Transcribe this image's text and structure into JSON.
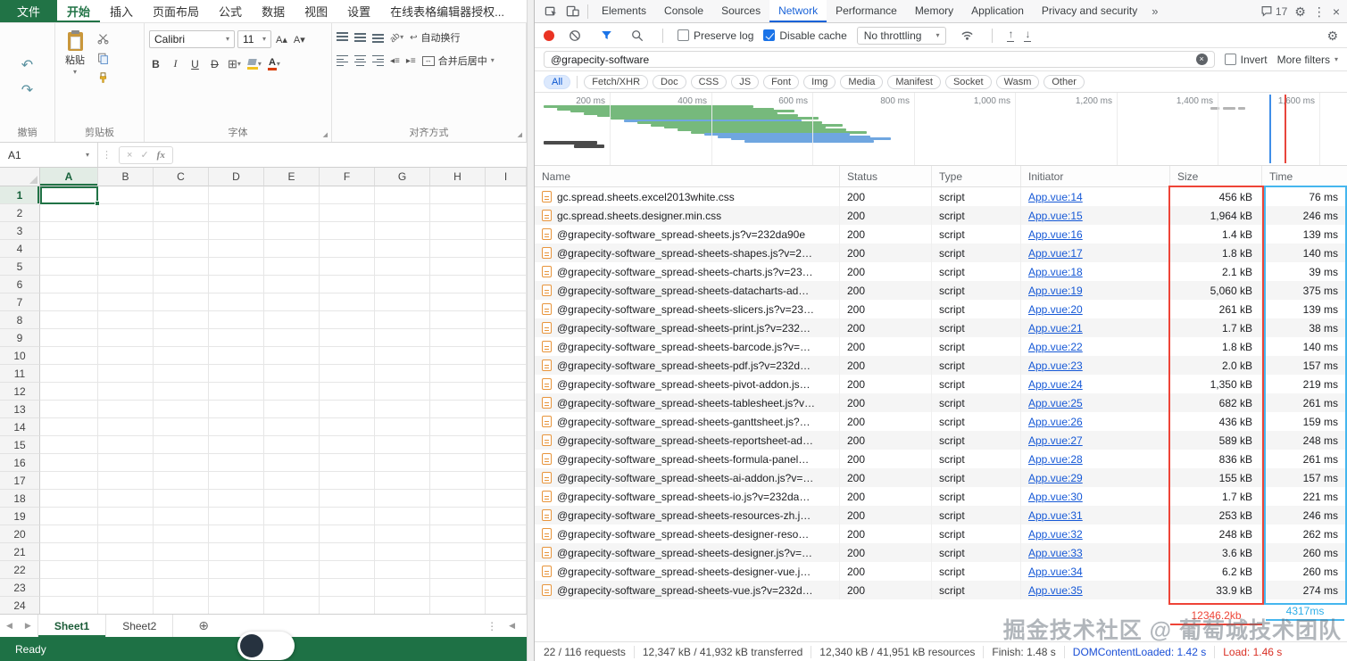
{
  "icons": {
    "undo": "↶",
    "redo": "↷",
    "caret": "▾",
    "kebab": "⋮",
    "close": "×",
    "gear": "⚙",
    "more_tabs": "»",
    "check": "✓",
    "cancel": "×",
    "clear": "×",
    "plus": "⊕",
    "nav_left": "◀",
    "nav_right": "▶",
    "increase_font": "A▴",
    "decrease_font": "A▾",
    "wrap": "↩",
    "merge_arrows": "↔",
    "orientation": "ab",
    "bold": "B",
    "italic": "I",
    "underline": "U",
    "strikethrough": "D",
    "font_color": "A",
    "borders_grid": "⊞",
    "indent_decrease": "◂≡",
    "indent_increase": "▸≡",
    "launcher": "◢"
  },
  "spreadsheet": {
    "menu": {
      "file_tab": "文件",
      "tabs": [
        "开始",
        "插入",
        "页面布局",
        "公式",
        "数据",
        "视图",
        "设置",
        "在线表格编辑器授权..."
      ],
      "active_tab": "开始"
    },
    "ribbon": {
      "groups": {
        "undo": "撤销",
        "clipboard": "剪贴板",
        "font": "字体",
        "alignment": "对齐方式"
      },
      "paste_label": "粘贴",
      "font_name": "Calibri",
      "font_size": "11",
      "wrap_label": "自动换行",
      "merge_label": "合并后居中"
    },
    "formula_bar": {
      "cell_ref": "A1",
      "fx_label": "fx"
    },
    "grid": {
      "columns": [
        "A",
        "B",
        "C",
        "D",
        "E",
        "F",
        "G",
        "H",
        "I"
      ],
      "visible_rows": 24,
      "selected_cell": "A1",
      "selected_column": "A",
      "selected_row": 1
    },
    "sheets": [
      "Sheet1",
      "Sheet2"
    ],
    "active_sheet": "Sheet1",
    "status_text": "Ready"
  },
  "devtools": {
    "tabs": [
      "Elements",
      "Console",
      "Sources",
      "Network",
      "Performance",
      "Memory",
      "Application",
      "Privacy and security"
    ],
    "active_tab": "Network",
    "issues_count": "17",
    "toolbar": {
      "preserve_log": "Preserve log",
      "disable_cache": "Disable cache",
      "throttling": "No throttling"
    },
    "filter": {
      "value": "@grapecity-software",
      "invert": "Invert",
      "more_filters": "More filters"
    },
    "chips": [
      "All",
      "Fetch/XHR",
      "Doc",
      "CSS",
      "JS",
      "Font",
      "Img",
      "Media",
      "Manifest",
      "Socket",
      "Wasm",
      "Other"
    ],
    "active_chip": "All",
    "overview_ticks": [
      "200 ms",
      "400 ms",
      "600 ms",
      "800 ms",
      "1,000 ms",
      "1,200 ms",
      "1,400 ms",
      "1,600 ms"
    ],
    "table": {
      "columns": [
        "Name",
        "Status",
        "Type",
        "Initiator",
        "Size",
        "Time"
      ],
      "requests": [
        {
          "name": "gc.spread.sheets.excel2013white.css",
          "status": "200",
          "type": "script",
          "initiator": "App.vue:14",
          "size": "456 kB",
          "time": "76 ms"
        },
        {
          "name": "gc.spread.sheets.designer.min.css",
          "status": "200",
          "type": "script",
          "initiator": "App.vue:15",
          "size": "1,964 kB",
          "time": "246 ms"
        },
        {
          "name": "@grapecity-software_spread-sheets.js?v=232da90e",
          "status": "200",
          "type": "script",
          "initiator": "App.vue:16",
          "size": "1.4 kB",
          "time": "139 ms"
        },
        {
          "name": "@grapecity-software_spread-sheets-shapes.js?v=2…",
          "status": "200",
          "type": "script",
          "initiator": "App.vue:17",
          "size": "1.8 kB",
          "time": "140 ms"
        },
        {
          "name": "@grapecity-software_spread-sheets-charts.js?v=23…",
          "status": "200",
          "type": "script",
          "initiator": "App.vue:18",
          "size": "2.1 kB",
          "time": "39 ms"
        },
        {
          "name": "@grapecity-software_spread-sheets-datacharts-ad…",
          "status": "200",
          "type": "script",
          "initiator": "App.vue:19",
          "size": "5,060 kB",
          "time": "375 ms"
        },
        {
          "name": "@grapecity-software_spread-sheets-slicers.js?v=23…",
          "status": "200",
          "type": "script",
          "initiator": "App.vue:20",
          "size": "261 kB",
          "time": "139 ms"
        },
        {
          "name": "@grapecity-software_spread-sheets-print.js?v=232…",
          "status": "200",
          "type": "script",
          "initiator": "App.vue:21",
          "size": "1.7 kB",
          "time": "38 ms"
        },
        {
          "name": "@grapecity-software_spread-sheets-barcode.js?v=…",
          "status": "200",
          "type": "script",
          "initiator": "App.vue:22",
          "size": "1.8 kB",
          "time": "140 ms"
        },
        {
          "name": "@grapecity-software_spread-sheets-pdf.js?v=232d…",
          "status": "200",
          "type": "script",
          "initiator": "App.vue:23",
          "size": "2.0 kB",
          "time": "157 ms"
        },
        {
          "name": "@grapecity-software_spread-sheets-pivot-addon.js…",
          "status": "200",
          "type": "script",
          "initiator": "App.vue:24",
          "size": "1,350 kB",
          "time": "219 ms"
        },
        {
          "name": "@grapecity-software_spread-sheets-tablesheet.js?v…",
          "status": "200",
          "type": "script",
          "initiator": "App.vue:25",
          "size": "682 kB",
          "time": "261 ms"
        },
        {
          "name": "@grapecity-software_spread-sheets-ganttsheet.js?…",
          "status": "200",
          "type": "script",
          "initiator": "App.vue:26",
          "size": "436 kB",
          "time": "159 ms"
        },
        {
          "name": "@grapecity-software_spread-sheets-reportsheet-ad…",
          "status": "200",
          "type": "script",
          "initiator": "App.vue:27",
          "size": "589 kB",
          "time": "248 ms"
        },
        {
          "name": "@grapecity-software_spread-sheets-formula-panel…",
          "status": "200",
          "type": "script",
          "initiator": "App.vue:28",
          "size": "836 kB",
          "time": "261 ms"
        },
        {
          "name": "@grapecity-software_spread-sheets-ai-addon.js?v=…",
          "status": "200",
          "type": "script",
          "initiator": "App.vue:29",
          "size": "155 kB",
          "time": "157 ms"
        },
        {
          "name": "@grapecity-software_spread-sheets-io.js?v=232da…",
          "status": "200",
          "type": "script",
          "initiator": "App.vue:30",
          "size": "1.7 kB",
          "time": "221 ms"
        },
        {
          "name": "@grapecity-software_spread-sheets-resources-zh.j…",
          "status": "200",
          "type": "script",
          "initiator": "App.vue:31",
          "size": "253 kB",
          "time": "246 ms"
        },
        {
          "name": "@grapecity-software_spread-sheets-designer-reso…",
          "status": "200",
          "type": "script",
          "initiator": "App.vue:32",
          "size": "248 kB",
          "time": "262 ms"
        },
        {
          "name": "@grapecity-software_spread-sheets-designer.js?v=…",
          "status": "200",
          "type": "script",
          "initiator": "App.vue:33",
          "size": "3.6 kB",
          "time": "260 ms"
        },
        {
          "name": "@grapecity-software_spread-sheets-designer-vue.j…",
          "status": "200",
          "type": "script",
          "initiator": "App.vue:34",
          "size": "6.2 kB",
          "time": "260 ms"
        },
        {
          "name": "@grapecity-software_spread-sheets-vue.js?v=232d…",
          "status": "200",
          "type": "script",
          "initiator": "App.vue:35",
          "size": "33.9 kB",
          "time": "274 ms"
        }
      ],
      "size_total": "12346.2kb",
      "time_total": "4317ms"
    },
    "statusbar": {
      "requests": "22 / 116 requests",
      "transferred": "12,347 kB / 41,932 kB transferred",
      "resources": "12,340 kB / 41,951 kB resources",
      "finish": "Finish: 1.48 s",
      "dcl": "DOMContentLoaded: 1.42 s",
      "load": "Load: 1.46 s"
    },
    "watermark": "掘金技术社区 @ 葡萄城技术团队"
  }
}
